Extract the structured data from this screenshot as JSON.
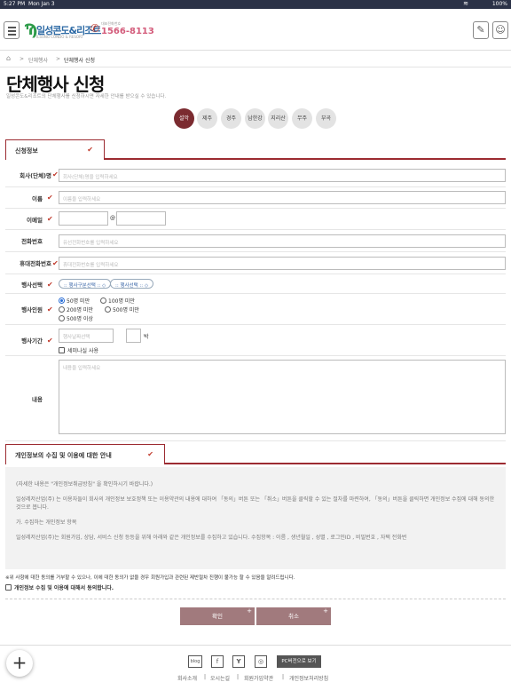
{
  "status": {
    "time": "5:27 PM",
    "date": "Mon Jan 3",
    "battery": "100%"
  },
  "header": {
    "logo_text": "일성콘도&리조트",
    "logo_sub": "ILSUNG CONDO & RESORT",
    "call_label": "대표전화번호",
    "phone": "1566-8113"
  },
  "breadcrumb": {
    "home": "⌂",
    "parent": "단체행사",
    "current": "단체행사 신청"
  },
  "page": {
    "title": "단체행사 신청",
    "description": "일성콘도&리조트의 단체행사를 신청하시면 자세한 안내를 받으실 수 있습니다."
  },
  "regions": [
    "설악",
    "제주",
    "경주",
    "남한강",
    "지리산",
    "무주",
    "부곡"
  ],
  "active_region": "설악",
  "form": {
    "section_title": "신청정보",
    "company": {
      "label": "회사(단체)명",
      "placeholder": "회사(단체)명을 입력하세요"
    },
    "name": {
      "label": "이름",
      "placeholder": "이름을 입력하세요"
    },
    "email": {
      "label": "이메일",
      "at": "@"
    },
    "phone": {
      "label": "전화번호",
      "placeholder": "유선전화번호를 입력하세요"
    },
    "mobile": {
      "label": "휴대전화번호",
      "placeholder": "휴대전화번호를 입력하세요"
    },
    "event": {
      "label": "행사선택",
      "select1": ":: 행사구분선택 :: ◇",
      "select2": ":: 행사선택 :: ◇"
    },
    "people": {
      "label": "행사인원",
      "options": [
        "50명 미만",
        "100명 미만",
        "200명 미만",
        "500명 미만",
        "500명 이상"
      ],
      "selected": "50명 미만"
    },
    "period": {
      "label": "행사기간",
      "date_placeholder": "행사날짜선택",
      "nights_unit": "박",
      "seminar_label": "세미나실 사용"
    },
    "content": {
      "label": "내용",
      "placeholder": "내용을 입력하세요"
    }
  },
  "privacy": {
    "section_title": "개인정보의 수집 및 이용에 대한 안내",
    "para1": "(자세한 내용은 \"개인정보취급방침\" 을 확인하시기 바랍니다.)",
    "para2": "일성레저산업(주) 는 이용자들이 회사의 개인정보 보호정책 또는 이용약관의 내용에 대하여 「동의」버튼 또는 「취소」버튼을 클릭할 수 있는 절차를 마련하여, 「동의」버튼을 클릭하면 개인정보 수집에 대해 동의한 것으로 봅니다.",
    "para3": "가. 수집하는 개인정보 항목",
    "para4": "일성레저산업(주)는 회원가입, 상담, 서비스 신청 등등을 위해 아래와 같은 개인정보를 수집하고 있습니다. 수집항목 : 이름 , 생년월일 , 성별 , 로그인ID , 비밀번호 , 자택 전화번",
    "notice": "※위 사항에 대한 동의를 거부할 수 있으나, 이에 대한 동의가 없을 경우 회원가입과 관련된 제반절차 진행이 불가능 할 수 있음을 알려드립니다.",
    "agree_label": "개인정보 수집 및 이용에 대해서 동의합니다."
  },
  "buttons": {
    "confirm": "확인",
    "cancel": "취소"
  },
  "footer": {
    "icons": [
      "blog",
      "f",
      "Y",
      "◎"
    ],
    "pc_view": "PC버전으로 보기",
    "links": [
      "회사소개",
      "오시는길",
      "회원가입약관",
      "개인정보처리방침"
    ]
  },
  "colors": {
    "accent": "#9c2b31",
    "active_region": "#7b2b30",
    "button": "#a17a7d",
    "statusbar": "#2b3247"
  }
}
